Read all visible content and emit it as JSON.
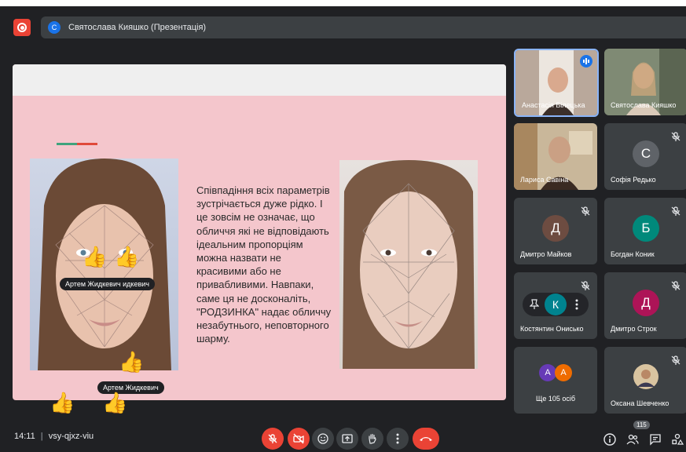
{
  "presentation": {
    "avatar_letter": "С",
    "title": "Святослава Кияшко (Презентація)"
  },
  "slide": {
    "text": "Співпадіння всіх параметрів зустрічається дуже рідко. І це зовсім не означає, що обличчя які не відповідають ідеальним пропорціям можна назвати не красивими або не привабливими. Навпаки, саме ця не досконаліть, \"РОДЗИНКА\" надає обличчу незабутнього, неповторного шарму.",
    "reaction_name_1": "Артем Жидкевич идкевич",
    "reaction_name_2": "Артем Жидкевич",
    "reaction_emoji": "👍"
  },
  "participants": [
    {
      "name": "Анастасія Білецька",
      "speaking": true
    },
    {
      "name": "Святослава Кияшко"
    },
    {
      "name": "Лариса Савіна"
    },
    {
      "name": "Софія Редько",
      "initial": "С",
      "color": "#5f6368"
    },
    {
      "name": "Дмитро Майков",
      "initial": "Д",
      "color": "#6d4c41"
    },
    {
      "name": "Богдан Коник",
      "initial": "Б",
      "color": "#00897b"
    },
    {
      "name": "Костянтин Онисько",
      "initial": "К",
      "color": "#00838f"
    },
    {
      "name": "Дмитро Строк",
      "initial": "Д",
      "color": "#ad1457"
    },
    {
      "name": "Ще 105 осіб",
      "initials": [
        "А",
        "А"
      ]
    },
    {
      "name": "Оксана Шевченко"
    }
  ],
  "bottom": {
    "time": "14:11",
    "separator": "|",
    "meeting_code": "vsy-qjxz-viu",
    "participant_count": "115"
  }
}
